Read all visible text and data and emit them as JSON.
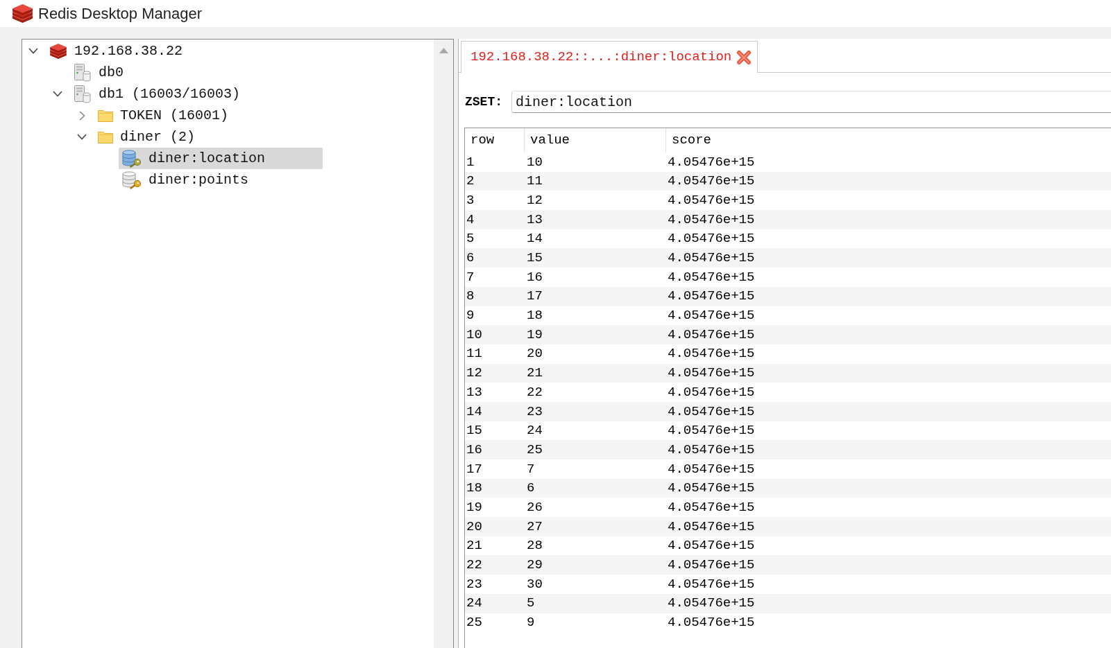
{
  "window": {
    "title": "Redis Desktop Manager"
  },
  "tree": [
    {
      "label": "192.168.38.22",
      "kind": "server",
      "expanded": true,
      "selected": false,
      "children": [
        {
          "label": "db0",
          "kind": "database",
          "selected": false
        },
        {
          "label": "db1 (16003/16003)",
          "kind": "database",
          "expanded": true,
          "selected": false,
          "children": [
            {
              "label": "TOKEN (16001)",
              "kind": "folder",
              "expanded": false,
              "selected": false
            },
            {
              "label": "diner (2)",
              "kind": "folder",
              "expanded": true,
              "selected": false,
              "children": [
                {
                  "label": "diner:location",
                  "kind": "key",
                  "selected": true
                },
                {
                  "label": "diner:points",
                  "kind": "key",
                  "selected": false
                }
              ]
            }
          ]
        }
      ]
    }
  ],
  "tabs": [
    {
      "label": "192.168.38.22::...:diner:location",
      "selected": true
    }
  ],
  "key_editor": {
    "type_label": "ZSET:",
    "key_name": "diner:location"
  },
  "table": {
    "columns": [
      "row",
      "value",
      "score"
    ],
    "rows": [
      [
        "1",
        "10",
        "4.05476e+15"
      ],
      [
        "2",
        "11",
        "4.05476e+15"
      ],
      [
        "3",
        "12",
        "4.05476e+15"
      ],
      [
        "4",
        "13",
        "4.05476e+15"
      ],
      [
        "5",
        "14",
        "4.05476e+15"
      ],
      [
        "6",
        "15",
        "4.05476e+15"
      ],
      [
        "7",
        "16",
        "4.05476e+15"
      ],
      [
        "8",
        "17",
        "4.05476e+15"
      ],
      [
        "9",
        "18",
        "4.05476e+15"
      ],
      [
        "10",
        "19",
        "4.05476e+15"
      ],
      [
        "11",
        "20",
        "4.05476e+15"
      ],
      [
        "12",
        "21",
        "4.05476e+15"
      ],
      [
        "13",
        "22",
        "4.05476e+15"
      ],
      [
        "14",
        "23",
        "4.05476e+15"
      ],
      [
        "15",
        "24",
        "4.05476e+15"
      ],
      [
        "16",
        "25",
        "4.05476e+15"
      ],
      [
        "17",
        "7",
        "4.05476e+15"
      ],
      [
        "18",
        "6",
        "4.05476e+15"
      ],
      [
        "19",
        "26",
        "4.05476e+15"
      ],
      [
        "20",
        "27",
        "4.05476e+15"
      ],
      [
        "21",
        "28",
        "4.05476e+15"
      ],
      [
        "22",
        "29",
        "4.05476e+15"
      ],
      [
        "23",
        "30",
        "4.05476e+15"
      ],
      [
        "24",
        "5",
        "4.05476e+15"
      ],
      [
        "25",
        "9",
        "4.05476e+15"
      ]
    ]
  }
}
